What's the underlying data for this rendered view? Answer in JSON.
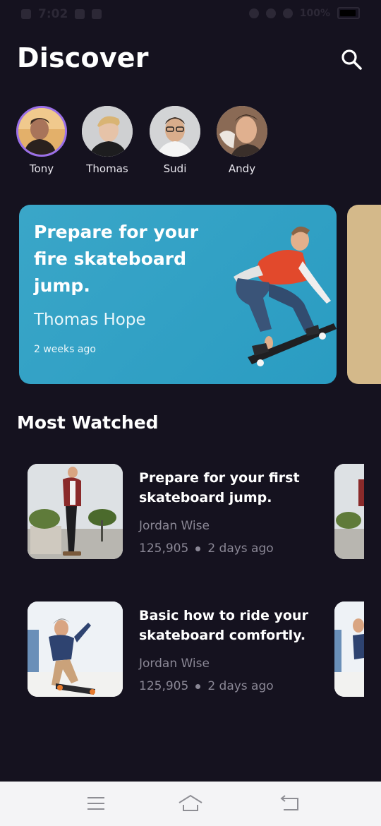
{
  "status_bar": {
    "time": "7:02",
    "battery": "100%"
  },
  "header": {
    "title": "Discover"
  },
  "stories": [
    {
      "name": "Tony",
      "active": true
    },
    {
      "name": "Thomas",
      "active": false
    },
    {
      "name": "Sudi",
      "active": false
    },
    {
      "name": "Andy",
      "active": false
    }
  ],
  "featured": {
    "title": "Prepare for your fire skateboard jump.",
    "author": "Thomas Hope",
    "time": "2 weeks ago",
    "background": "#2ea3c6"
  },
  "most_watched": {
    "title": "Most Watched",
    "videos": [
      {
        "title": "Prepare for your first skateboard jump.",
        "author": "Jordan Wise",
        "views": "125,905",
        "time": "2 days ago"
      },
      {
        "title": "Basic how to ride your skateboard comfortly.",
        "author": "Jordan Wise",
        "views": "125,905",
        "time": "2 days ago"
      }
    ]
  },
  "nav_bar": {
    "icons": [
      "menu-icon",
      "home-icon",
      "back-icon"
    ]
  }
}
